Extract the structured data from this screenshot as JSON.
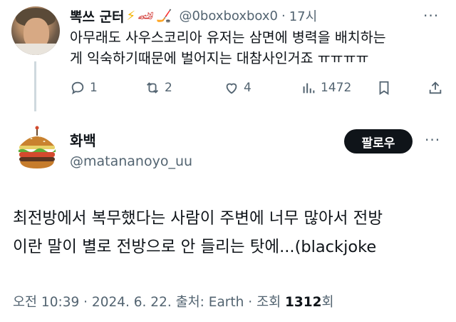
{
  "reply": {
    "display_name": "뽁쓰 군터",
    "emoji": [
      "⚡",
      "🏎",
      "🏒"
    ],
    "handle": "@0boxboxbox0",
    "dot": "·",
    "time": "17시",
    "text_line1": "아무래도 사우스코리아 유저는 삼면에 병력을 배치하는",
    "text_line2": "게 익숙하기때문에 벌어지는 대참사인거죠 ㅠㅠㅠㅠ",
    "actions": {
      "replies": "1",
      "retweets": "2",
      "likes": "4",
      "views": "1472"
    }
  },
  "tweet": {
    "display_name": "화백",
    "handle": "@matananoyo_uu",
    "follow_label": "팔로우",
    "text_line1": "최전방에서 복무했다는 사람이 주변에 너무 많아서 전방",
    "text_line2": "이란 말이 별로 전방으로 안 들리는 탓에...(blackjoke",
    "meta": {
      "time": "오전 10:39",
      "sep1": "·",
      "date": "2024. 6. 22.",
      "source_label": "출처:",
      "source": "Earth",
      "sep2": "·",
      "views_label": "조회",
      "views_count": "1312",
      "views_suffix": "회"
    }
  },
  "colors": {
    "text": "#0f1419",
    "secondary": "#536471",
    "thread_line": "#cfd9de",
    "follow_bg": "#0f1419"
  },
  "icons": [
    "reply-icon",
    "retweet-icon",
    "like-icon",
    "views-icon",
    "bookmark-icon",
    "share-icon",
    "more-icon"
  ]
}
